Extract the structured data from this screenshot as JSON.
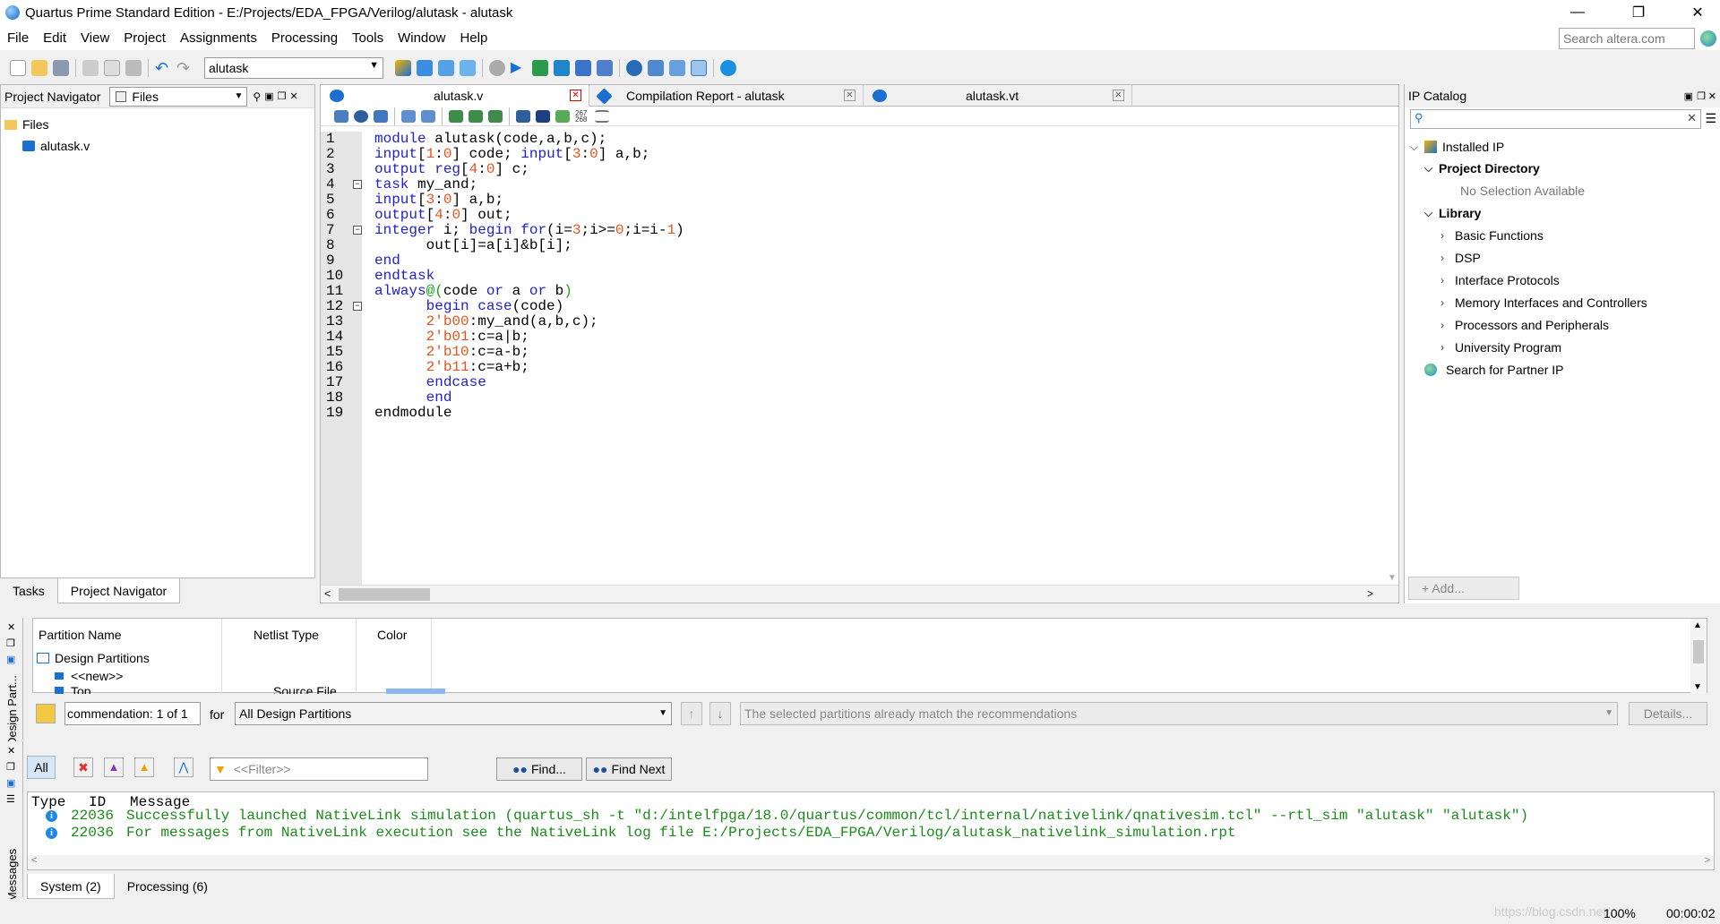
{
  "window": {
    "title": "Quartus Prime Standard Edition - E:/Projects/EDA_FPGA/Verilog/alutask - alutask",
    "minimize": "—",
    "restore": "❐",
    "close": "✕"
  },
  "menu": [
    "File",
    "Edit",
    "View",
    "Project",
    "Assignments",
    "Processing",
    "Tools",
    "Window",
    "Help"
  ],
  "search": {
    "placeholder": "Search altera.com"
  },
  "toolbar": {
    "project_select": "alutask"
  },
  "left_panel": {
    "title": "Project Navigator",
    "view_select": "Files",
    "tree_root": "Files",
    "tree_file": "alutask.v",
    "tabs": [
      "Tasks",
      "Project Navigator"
    ]
  },
  "editor": {
    "tabs": [
      {
        "label": "alutask.v",
        "active": true
      },
      {
        "label": "Compilation Report - alutask",
        "active": false
      },
      {
        "label": "alutask.vt",
        "active": false
      }
    ],
    "lines": [
      {
        "n": "1",
        "fold": "",
        "parts": [
          {
            "t": "module",
            "c": "kw"
          },
          {
            "t": " alutask(code,a,b,c);",
            "c": ""
          }
        ]
      },
      {
        "n": "2",
        "fold": "",
        "parts": [
          {
            "t": "input",
            "c": "kw"
          },
          {
            "t": "[",
            "c": ""
          },
          {
            "t": "1",
            "c": "num"
          },
          {
            "t": ":",
            "c": ""
          },
          {
            "t": "0",
            "c": "num"
          },
          {
            "t": "] code; ",
            "c": ""
          },
          {
            "t": "input",
            "c": "kw"
          },
          {
            "t": "[",
            "c": ""
          },
          {
            "t": "3",
            "c": "num"
          },
          {
            "t": ":",
            "c": ""
          },
          {
            "t": "0",
            "c": "num"
          },
          {
            "t": "] a,b;",
            "c": ""
          }
        ]
      },
      {
        "n": "3",
        "fold": "",
        "parts": [
          {
            "t": "output reg",
            "c": "kw"
          },
          {
            "t": "[",
            "c": ""
          },
          {
            "t": "4",
            "c": "num"
          },
          {
            "t": ":",
            "c": ""
          },
          {
            "t": "0",
            "c": "num"
          },
          {
            "t": "] c;",
            "c": ""
          }
        ]
      },
      {
        "n": "4",
        "fold": "−",
        "parts": [
          {
            "t": "task",
            "c": "kw"
          },
          {
            "t": " my_and;",
            "c": ""
          }
        ]
      },
      {
        "n": "5",
        "fold": "",
        "parts": [
          {
            "t": "input",
            "c": "kw"
          },
          {
            "t": "[",
            "c": ""
          },
          {
            "t": "3",
            "c": "num"
          },
          {
            "t": ":",
            "c": ""
          },
          {
            "t": "0",
            "c": "num"
          },
          {
            "t": "] a,b;",
            "c": ""
          }
        ]
      },
      {
        "n": "6",
        "fold": "",
        "parts": [
          {
            "t": "output",
            "c": "kw"
          },
          {
            "t": "[",
            "c": ""
          },
          {
            "t": "4",
            "c": "num"
          },
          {
            "t": ":",
            "c": ""
          },
          {
            "t": "0",
            "c": "num"
          },
          {
            "t": "] out;",
            "c": ""
          }
        ]
      },
      {
        "n": "7",
        "fold": "−",
        "parts": [
          {
            "t": "integer",
            "c": "kw"
          },
          {
            "t": " i; ",
            "c": ""
          },
          {
            "t": "begin for",
            "c": "kw"
          },
          {
            "t": "(i=",
            "c": ""
          },
          {
            "t": "3",
            "c": "num"
          },
          {
            "t": ";i>=",
            "c": ""
          },
          {
            "t": "0",
            "c": "num"
          },
          {
            "t": ";i=i-",
            "c": ""
          },
          {
            "t": "1",
            "c": "num"
          },
          {
            "t": ")",
            "c": ""
          }
        ]
      },
      {
        "n": "8",
        "fold": "",
        "parts": [
          {
            "t": "      out[i]=a[i]&b[i];",
            "c": ""
          }
        ]
      },
      {
        "n": "9",
        "fold": "",
        "parts": [
          {
            "t": "end",
            "c": "kw"
          }
        ]
      },
      {
        "n": "10",
        "fold": "",
        "parts": [
          {
            "t": "endtask",
            "c": "kw"
          }
        ]
      },
      {
        "n": "11",
        "fold": "",
        "parts": [
          {
            "t": "always",
            "c": "kw"
          },
          {
            "t": "@(",
            "c": "grn"
          },
          {
            "t": "code ",
            "c": ""
          },
          {
            "t": "or",
            "c": "kw"
          },
          {
            "t": " a ",
            "c": ""
          },
          {
            "t": "or",
            "c": "kw"
          },
          {
            "t": " b",
            "c": ""
          },
          {
            "t": ")",
            "c": "grn"
          }
        ]
      },
      {
        "n": "12",
        "fold": "−",
        "parts": [
          {
            "t": "      ",
            "c": ""
          },
          {
            "t": "begin case",
            "c": "kw"
          },
          {
            "t": "(code)",
            "c": ""
          }
        ]
      },
      {
        "n": "13",
        "fold": "",
        "parts": [
          {
            "t": "      ",
            "c": ""
          },
          {
            "t": "2'b00",
            "c": "num"
          },
          {
            "t": ":my_and(a,b,c);",
            "c": ""
          }
        ]
      },
      {
        "n": "14",
        "fold": "",
        "parts": [
          {
            "t": "      ",
            "c": ""
          },
          {
            "t": "2'b01",
            "c": "num"
          },
          {
            "t": ":c=a|b;",
            "c": ""
          }
        ]
      },
      {
        "n": "15",
        "fold": "",
        "parts": [
          {
            "t": "      ",
            "c": ""
          },
          {
            "t": "2'b10",
            "c": "num"
          },
          {
            "t": ":c=a-b;",
            "c": ""
          }
        ]
      },
      {
        "n": "16",
        "fold": "",
        "parts": [
          {
            "t": "      ",
            "c": ""
          },
          {
            "t": "2'b11",
            "c": "num"
          },
          {
            "t": ":c=a+b;",
            "c": ""
          }
        ]
      },
      {
        "n": "17",
        "fold": "",
        "parts": [
          {
            "t": "      ",
            "c": ""
          },
          {
            "t": "endcase",
            "c": "kw"
          }
        ]
      },
      {
        "n": "18",
        "fold": "",
        "parts": [
          {
            "t": "      ",
            "c": ""
          },
          {
            "t": "end",
            "c": "kw"
          }
        ]
      },
      {
        "n": "19",
        "fold": "",
        "parts": [
          {
            "t": "endmodule",
            "c": ""
          }
        ]
      }
    ]
  },
  "ip_catalog": {
    "title": "IP Catalog",
    "installed": "Installed IP",
    "project_dir": "Project Directory",
    "no_selection": "No Selection Available",
    "library": "Library",
    "categories": [
      "Basic Functions",
      "DSP",
      "Interface Protocols",
      "Memory Interfaces and Controllers",
      "Processors and Peripherals",
      "University Program"
    ],
    "partner": "Search for Partner IP",
    "add_button": "+ Add..."
  },
  "partitions": {
    "side_label": "Design Part...",
    "headers": [
      "Partition Name",
      "Netlist Type",
      "Color"
    ],
    "root": "Design Partitions",
    "new_item": "<<new>>",
    "partial_row": [
      "Top",
      "Source File"
    ],
    "recommendation": "commendation: 1 of 1",
    "for_label": "for",
    "scope_select": "All Design Partitions",
    "status_text": "The selected partitions already match the recommendations",
    "details_button": "Details..."
  },
  "messages": {
    "side_label": "Messages",
    "all_button": "All",
    "filter_placeholder": "<<Filter>>",
    "find_button": "Find...",
    "find_next_button": "Find Next",
    "col_type": "Type",
    "col_id": "ID",
    "col_message": "Message",
    "rows": [
      {
        "id": "22036",
        "text": "Successfully launched NativeLink simulation (quartus_sh -t \"d:/intelfpga/18.0/quartus/common/tcl/internal/nativelink/qnativesim.tcl\" --rtl_sim \"alutask\" \"alutask\")"
      },
      {
        "id": "22036",
        "text": "For messages from NativeLink execution see the NativeLink log file E:/Projects/EDA_FPGA/Verilog/alutask_nativelink_simulation.rpt"
      }
    ],
    "tabs": [
      "System (2)",
      "Processing (6)"
    ]
  },
  "status": {
    "zoom": "100%",
    "time": "00:00:02",
    "watermark": "https://blog.csdn.net/..."
  },
  "colors": {
    "keyword": "#1f1fd1",
    "number": "#e8541e",
    "message_green": "#1a8a1a"
  }
}
